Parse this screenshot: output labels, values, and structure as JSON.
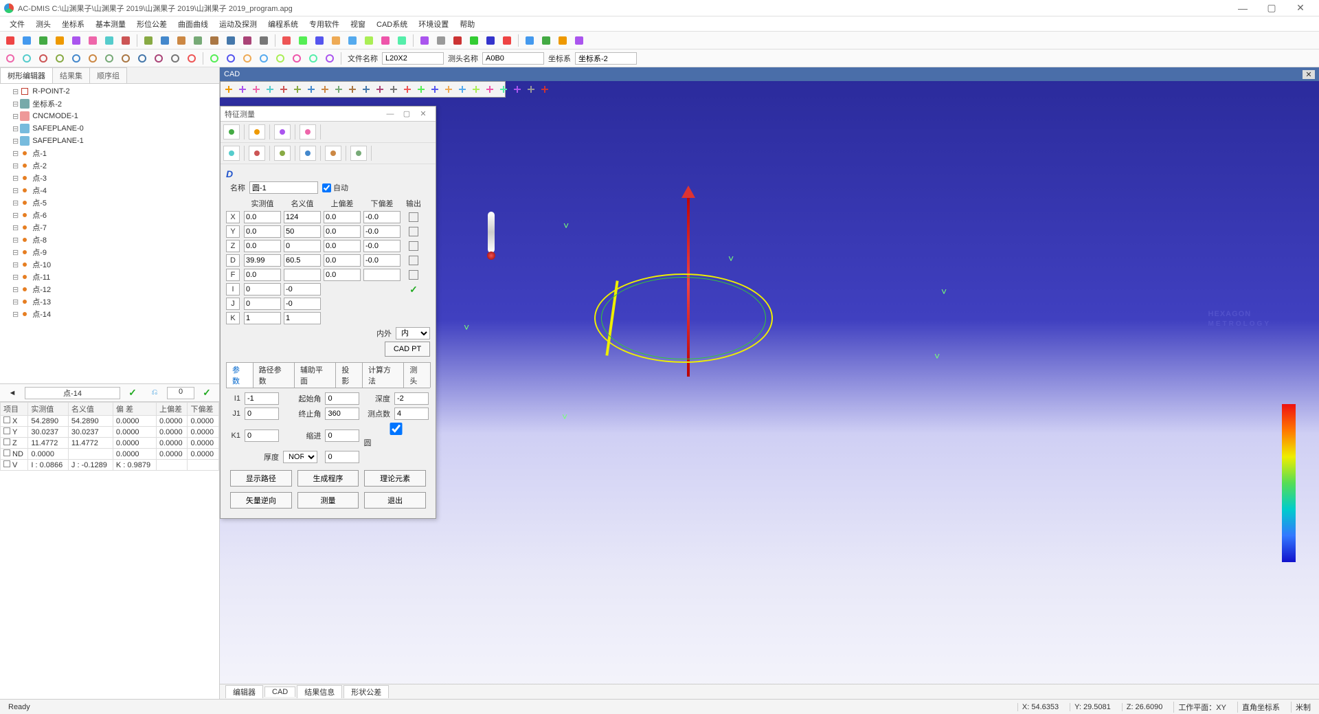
{
  "title": "AC-DMIS      C:\\山渊果子\\山渊果子 2019\\山渊果子 2019\\山渊果子 2019_program.apg",
  "menu": [
    "文件",
    "测头",
    "坐标系",
    "基本测量",
    "形位公差",
    "曲面曲线",
    "运动及探测",
    "编程系统",
    "专用软件",
    "视窗",
    "CAD系统",
    "环境设置",
    "帮助"
  ],
  "toolbar2_labels": {
    "filename": "文件名称",
    "probename": "测头名称",
    "coord": "坐标系"
  },
  "toolbar2_vals": {
    "filename": "L20X2",
    "probename": "A0B0",
    "coord": "坐标系-2"
  },
  "tree_tabs": [
    "树形编辑器",
    "结果集",
    "顺序组"
  ],
  "tree": [
    {
      "icon": "rpoint",
      "label": "R-POINT-2"
    },
    {
      "icon": "axis",
      "label": "坐标系-2"
    },
    {
      "icon": "cnc",
      "label": "CNCMODE-1"
    },
    {
      "icon": "plane",
      "label": "SAFEPLANE-0"
    },
    {
      "icon": "plane",
      "label": "SAFEPLANE-1"
    },
    {
      "icon": "point",
      "label": "点-1"
    },
    {
      "icon": "point",
      "label": "点-2"
    },
    {
      "icon": "point",
      "label": "点-3"
    },
    {
      "icon": "point",
      "label": "点-4"
    },
    {
      "icon": "point",
      "label": "点-5"
    },
    {
      "icon": "point",
      "label": "点-6"
    },
    {
      "icon": "point",
      "label": "点-7"
    },
    {
      "icon": "point",
      "label": "点-8"
    },
    {
      "icon": "point",
      "label": "点-9"
    },
    {
      "icon": "point",
      "label": "点-10"
    },
    {
      "icon": "point",
      "label": "点-11"
    },
    {
      "icon": "point",
      "label": "点-12"
    },
    {
      "icon": "point",
      "label": "点-13"
    },
    {
      "icon": "point",
      "label": "点-14"
    }
  ],
  "midcombo": "点-14",
  "midzero": "0",
  "results": {
    "headers": [
      "项目",
      "实测值",
      "名义值",
      "偏 差",
      "上偏差",
      "下偏差"
    ],
    "rows": [
      [
        "X",
        "54.2890",
        "54.2890",
        "0.0000",
        "0.0000",
        "0.0000"
      ],
      [
        "Y",
        "30.0237",
        "30.0237",
        "0.0000",
        "0.0000",
        "0.0000"
      ],
      [
        "Z",
        "11.4772",
        "11.4772",
        "0.0000",
        "0.0000",
        "0.0000"
      ],
      [
        "ND",
        "0.0000",
        "",
        "0.0000",
        "0.0000",
        "0.0000"
      ],
      [
        "V",
        "I : 0.0866",
        "J : -0.1289",
        "K : 0.9879",
        "",
        ""
      ]
    ]
  },
  "cad_title": "CAD",
  "dlg": {
    "title": "特征测量",
    "name_lbl": "名称",
    "name_val": "圆-1",
    "auto_lbl": "自动",
    "grid_hdr": [
      "实测值",
      "名义值",
      "上偏差",
      "下偏差",
      "输出"
    ],
    "rows": {
      "X": [
        "0.0",
        "124",
        "0.0",
        "-0.0"
      ],
      "Y": [
        "0.0",
        "50",
        "0.0",
        "-0.0"
      ],
      "Z": [
        "0.0",
        "0",
        "0.0",
        "-0.0"
      ],
      "D": [
        "39.99",
        "60.5",
        "0.0",
        "-0.0"
      ],
      "F": [
        "0.0",
        "",
        "0.0",
        ""
      ],
      "I": [
        "0",
        "-0"
      ],
      "J": [
        "0",
        "-0"
      ],
      "K": [
        "1",
        "1"
      ]
    },
    "inout_lbl": "内外",
    "inout_val": "内",
    "cadpt": "CAD PT",
    "subtabs": [
      "参数",
      "路径参数",
      "辅助平面",
      "投影",
      "计算方法",
      "测头"
    ],
    "params": {
      "I1": "-1",
      "start_ang_lbl": "起始角",
      "start_ang": "0",
      "depth_lbl": "深度",
      "depth": "-2",
      "J1": "0",
      "end_ang_lbl": "终止角",
      "end_ang": "360",
      "pts_lbl": "测点数",
      "pts": "4",
      "K1": "0",
      "indent_lbl": "缩进",
      "indent": "0",
      "circle_lbl": "圆",
      "thick_lbl": "厚度",
      "thick_mode": "NOR",
      "thick": "0"
    },
    "btns": [
      "显示路径",
      "生成程序",
      "理论元素",
      "矢量逆向",
      "测量",
      "退出"
    ]
  },
  "hexlogo": "HEXAGON",
  "hexlogo_sub": "METROLOGY",
  "bottom_tabs": [
    "编辑器",
    "CAD",
    "结果信息",
    "形状公差"
  ],
  "status": {
    "ready": "Ready",
    "x": "X: 54.6353",
    "y": "Y: 29.5081",
    "z": "Z: 26.6090",
    "plane": "工作平面：XY",
    "sys": "直角坐标系",
    "unit": "米制"
  }
}
